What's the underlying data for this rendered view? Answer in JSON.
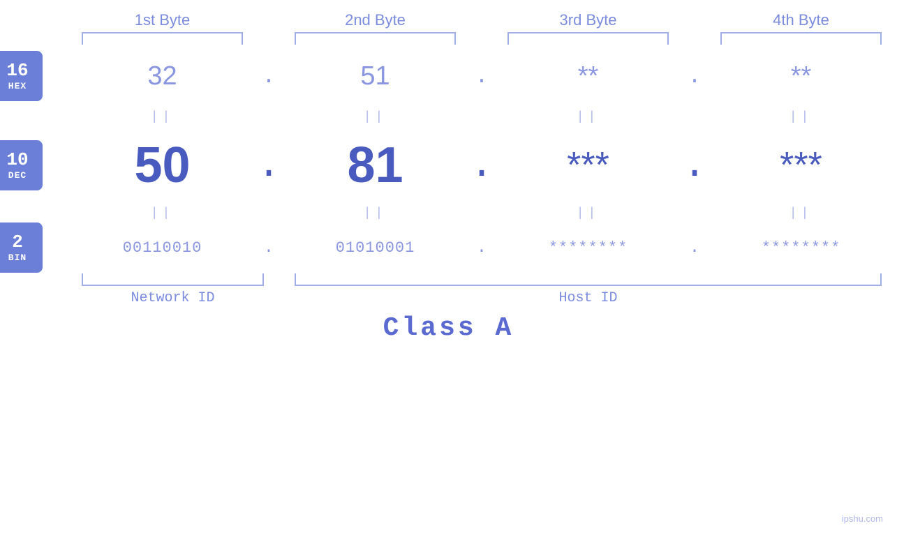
{
  "header": {
    "byte1_label": "1st Byte",
    "byte2_label": "2nd Byte",
    "byte3_label": "3rd Byte",
    "byte4_label": "4th Byte"
  },
  "badges": {
    "hex": {
      "number": "16",
      "label": "HEX"
    },
    "dec": {
      "number": "10",
      "label": "DEC"
    },
    "bin": {
      "number": "2",
      "label": "BIN"
    }
  },
  "hex_row": {
    "byte1": "32",
    "byte2": "51",
    "byte3": "**",
    "byte4": "**",
    "sep": "."
  },
  "dec_row": {
    "byte1": "50",
    "byte2": "81",
    "byte3": "***",
    "byte4": "***",
    "sep": "."
  },
  "bin_row": {
    "byte1": "00110010",
    "byte2": "01010001",
    "byte3": "********",
    "byte4": "********",
    "sep": "."
  },
  "equals_sign": "||",
  "labels": {
    "network_id": "Network ID",
    "host_id": "Host ID",
    "class": "Class A"
  },
  "watermark": "ipshu.com",
  "colors": {
    "badge_bg": "#6c7fd8",
    "text_light": "#8a96e0",
    "text_medium": "#7b8cde",
    "text_dark": "#4a5bbf",
    "bracket": "#a0aee8",
    "equals": "#b0b8ea"
  }
}
